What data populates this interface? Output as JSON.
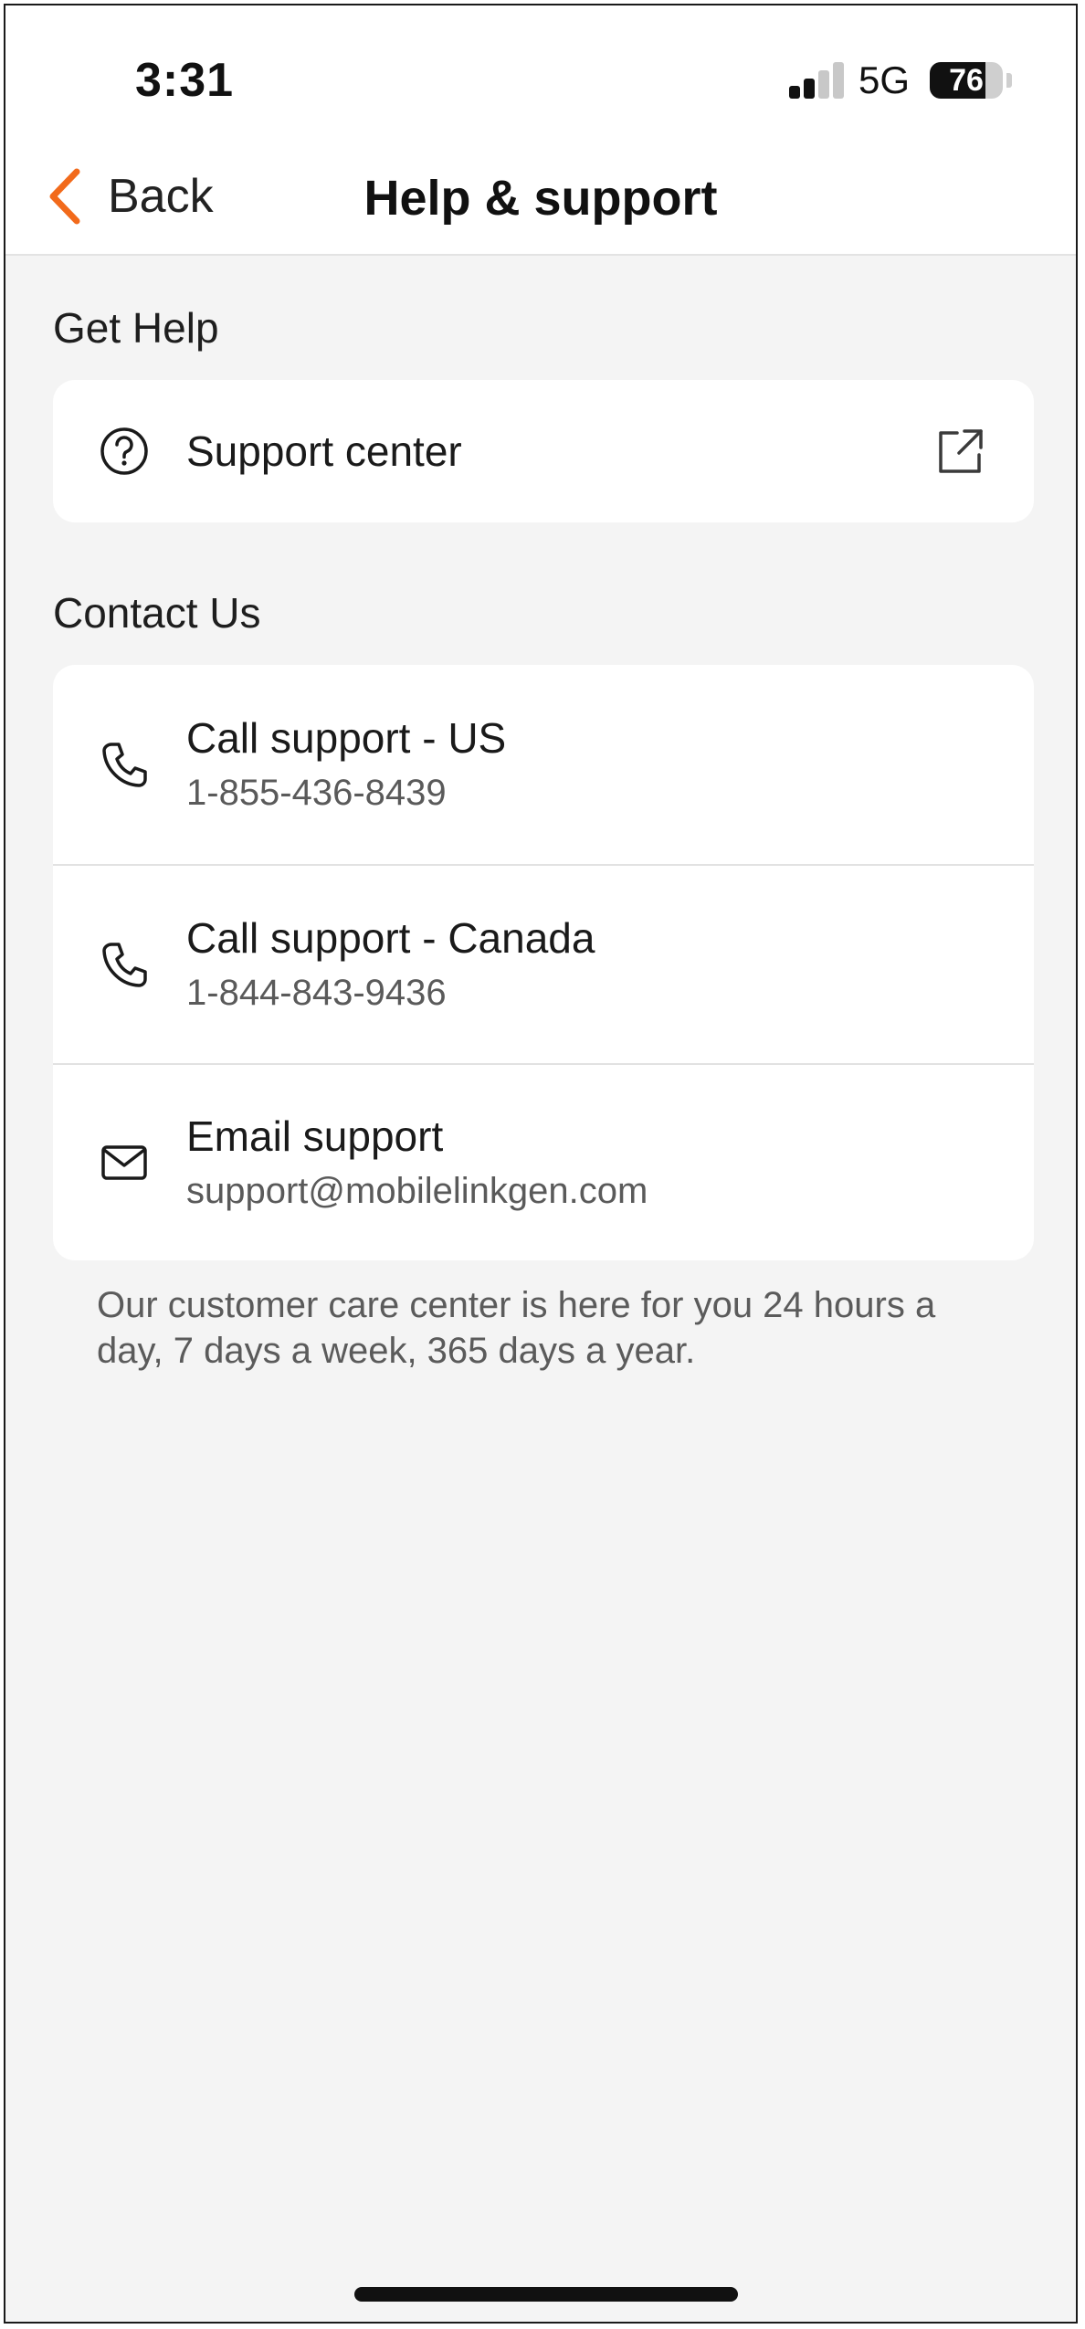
{
  "status_bar": {
    "time": "3:31",
    "network": "5G",
    "battery": "76",
    "battery_level": 0.76
  },
  "header": {
    "back_label": "Back",
    "title": "Help & support"
  },
  "get_help": {
    "label": "Get Help",
    "items": [
      {
        "title": "Support center",
        "icon": "help-circle-icon",
        "trailing_icon": "external-link-icon"
      }
    ]
  },
  "contact_us": {
    "label": "Contact Us",
    "items": [
      {
        "title": "Call support - US",
        "subtitle": "1-855-436-8439",
        "icon": "phone-icon"
      },
      {
        "title": "Call support - Canada",
        "subtitle": "1-844-843-9436",
        "icon": "phone-icon"
      },
      {
        "title": "Email support",
        "subtitle": "support@mobilelinkgen.com",
        "icon": "mail-icon"
      }
    ]
  },
  "footnote": "Our customer care center is here for you 24 hours a day, 7 days a week, 365 days a year.",
  "colors": {
    "accent": "#f26a1b",
    "background": "#f4f4f4",
    "card": "#ffffff",
    "divider": "#e2e2e2"
  }
}
